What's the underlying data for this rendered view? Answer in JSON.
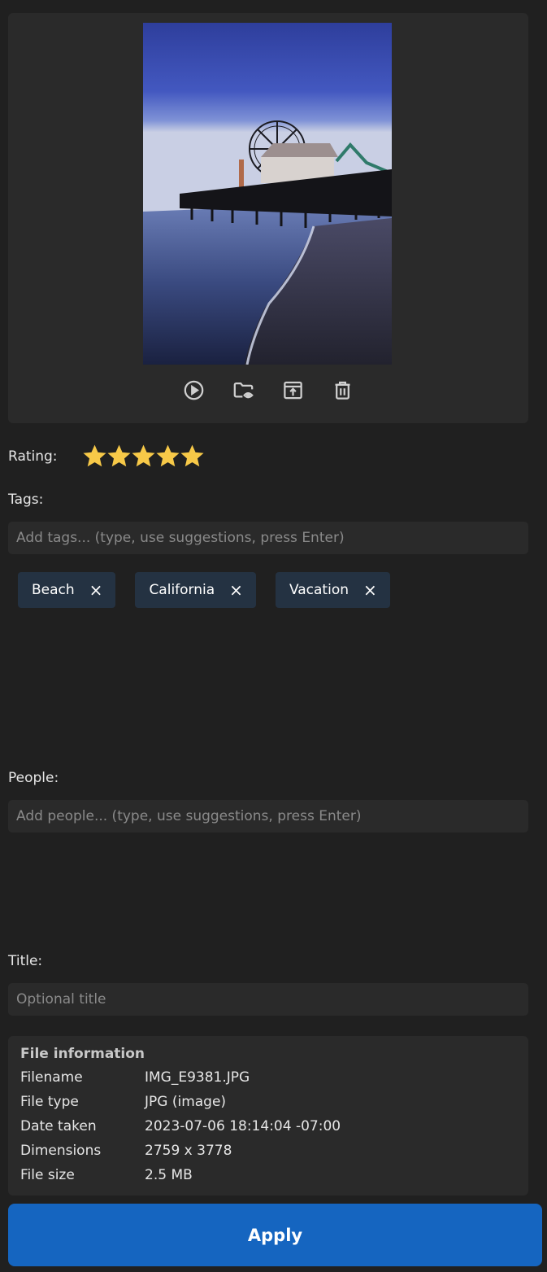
{
  "preview": {
    "actions": [
      {
        "name": "play-icon"
      },
      {
        "name": "folder-view-icon"
      },
      {
        "name": "open-external-icon"
      },
      {
        "name": "trash-icon"
      }
    ]
  },
  "rating": {
    "label": "Rating:",
    "value": 5,
    "max": 5,
    "star_color": "#f7c948"
  },
  "tags": {
    "label": "Tags:",
    "placeholder": "Add tags... (type, use suggestions, press Enter)",
    "items": [
      "Beach",
      "California",
      "Vacation"
    ],
    "remove_glyph": "×",
    "chip_color": "#243242"
  },
  "people": {
    "label": "People:",
    "placeholder": "Add people... (type, use suggestions, press Enter)"
  },
  "title": {
    "label": "Title:",
    "placeholder": "Optional title"
  },
  "file_info": {
    "heading": "File information",
    "rows": [
      {
        "key": "Filename",
        "value": "IMG_E9381.JPG"
      },
      {
        "key": "File type",
        "value": "JPG (image)"
      },
      {
        "key": "Date taken",
        "value": "2023-07-06 18:14:04 -07:00"
      },
      {
        "key": "Dimensions",
        "value": "2759 x 3778"
      },
      {
        "key": "File size",
        "value": "2.5 MB"
      }
    ]
  },
  "apply": {
    "label": "Apply",
    "color": "#1565c0"
  }
}
